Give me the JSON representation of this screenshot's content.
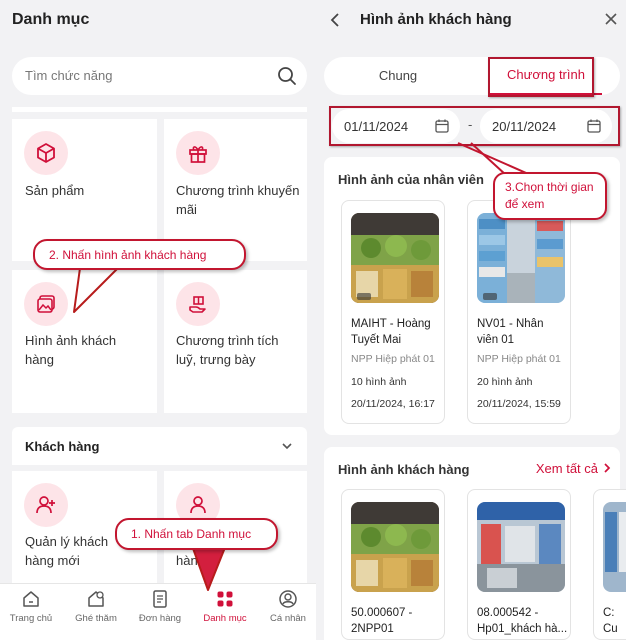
{
  "left": {
    "title": "Danh mục",
    "search_placeholder": "Tìm chức năng",
    "tiles": [
      {
        "label": "Sản phẩm",
        "icon": "cube-icon"
      },
      {
        "label": "Chương trình khuyến mãi",
        "icon": "gift-icon"
      },
      {
        "label": "Hình ảnh khách hàng",
        "icon": "image-icon"
      },
      {
        "label": "Chương trình tích luỹ, trưng bày",
        "icon": "hand-gift-icon"
      }
    ],
    "section": {
      "label": "Khách hàng"
    },
    "customer_tiles": [
      {
        "label": "Quản lý khách hàng mới",
        "icon": "add-user-icon"
      },
      {
        "label": "hàng",
        "icon": "user-icon"
      }
    ],
    "nav": [
      {
        "label": "Trang chủ",
        "icon": "home-icon"
      },
      {
        "label": "Ghé thăm",
        "icon": "visit-icon"
      },
      {
        "label": "Đơn hàng",
        "icon": "order-icon"
      },
      {
        "label": "Danh mục",
        "icon": "grid-icon",
        "active": true
      },
      {
        "label": "Cá nhân",
        "icon": "profile-icon"
      }
    ]
  },
  "callouts": {
    "step1": "1. Nhấn tab Danh mục",
    "step2": "2. Nhấn hình ảnh khách hàng",
    "step3": "3.Chọn thời gian để xem"
  },
  "right": {
    "title": "Hình ảnh khách hàng",
    "tabs": [
      "Chung",
      "Chương trình"
    ],
    "date_from": "01/11/2024",
    "date_to": "20/11/2024",
    "employee_section": "Hình ảnh của nhân viên",
    "employees": [
      {
        "name": "MAIHT - Hoàng Tuyết Mai",
        "distributor": "NPP Hiệp phát 01",
        "count": "10 hình ảnh",
        "time": "20/11/2024, 16:17"
      },
      {
        "name": "NV01 - Nhân viên 01",
        "distributor": "NPP Hiệp phát 01",
        "count": "20 hình ảnh",
        "time": "20/11/2024, 15:59"
      }
    ],
    "customer_section": "Hình ảnh khách hàng",
    "see_all": "Xem tất cả",
    "customers": [
      {
        "name": "50.000607 - 2NPP01"
      },
      {
        "name": "08.000542 - Hp01_khách hà..."
      },
      {
        "name": "C: Cu"
      }
    ]
  },
  "colors": {
    "accent": "#d0103a",
    "tile_icon_bg": "#fde4e8"
  }
}
